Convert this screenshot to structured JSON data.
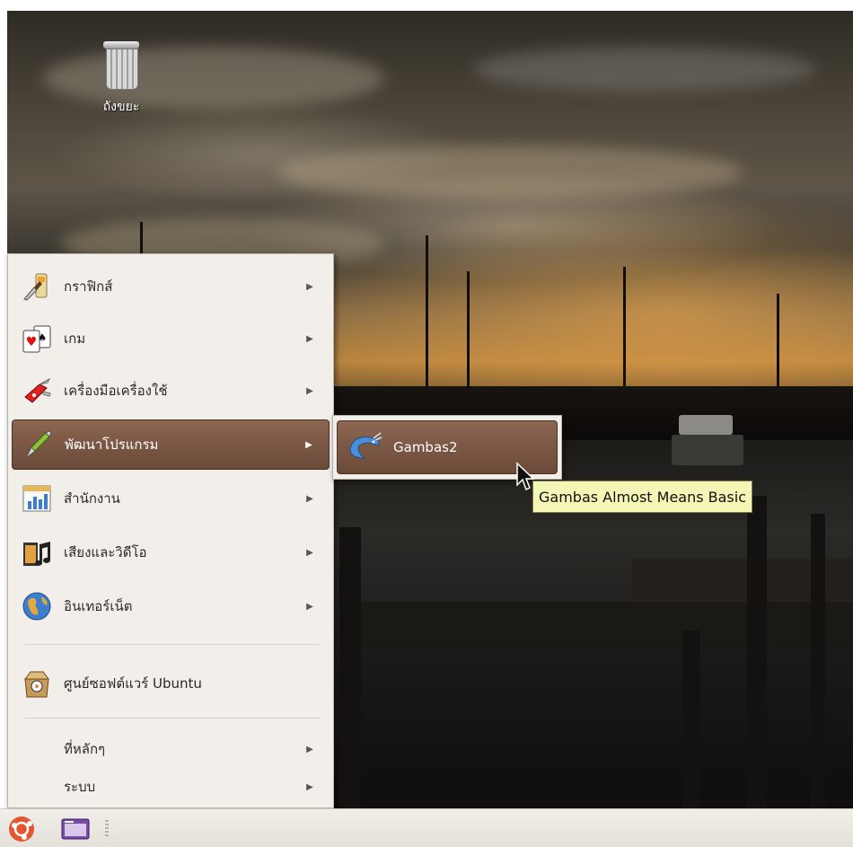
{
  "desktop": {
    "trash_label": "ถังขยะ"
  },
  "app_menu": {
    "items": [
      {
        "label": "กราฟิกส์",
        "icon": "graphics-icon",
        "has_submenu": true
      },
      {
        "label": "เกม",
        "icon": "games-icon",
        "has_submenu": true
      },
      {
        "label": "เครื่องมือเครื่องใช้",
        "icon": "accessories-icon",
        "has_submenu": true
      },
      {
        "label": "พัฒนาโปรแกรม",
        "icon": "programming-icon",
        "has_submenu": true,
        "active": true
      },
      {
        "label": "สำนักงาน",
        "icon": "office-icon",
        "has_submenu": true
      },
      {
        "label": "เสียงและวิดีโอ",
        "icon": "sound-video-icon",
        "has_submenu": true
      },
      {
        "label": "อินเทอร์เน็ต",
        "icon": "internet-icon",
        "has_submenu": true
      },
      {
        "label": "ศูนย์ซอฟต์แวร์ Ubuntu",
        "icon": "software-center-icon",
        "has_submenu": false
      },
      {
        "label": "ที่หลักๆ",
        "icon": "",
        "has_submenu": true
      },
      {
        "label": "ระบบ",
        "icon": "",
        "has_submenu": true
      }
    ],
    "arrow_glyph": "▶"
  },
  "submenu": {
    "items": [
      {
        "label": "Gambas2",
        "icon": "gambas-shrimp-icon",
        "active": true
      }
    ]
  },
  "tooltip": {
    "text": "Gambas Almost Means Basic"
  },
  "panel": {
    "main_menu_icon": "ubuntu-logo-icon",
    "launcher_icon": "window-launcher-icon"
  },
  "colors": {
    "menu_bg": "#f2efeb",
    "active_item": "#7a5644",
    "tooltip_bg": "#f5f5b5",
    "panel_bg": "#ebe8e3"
  }
}
